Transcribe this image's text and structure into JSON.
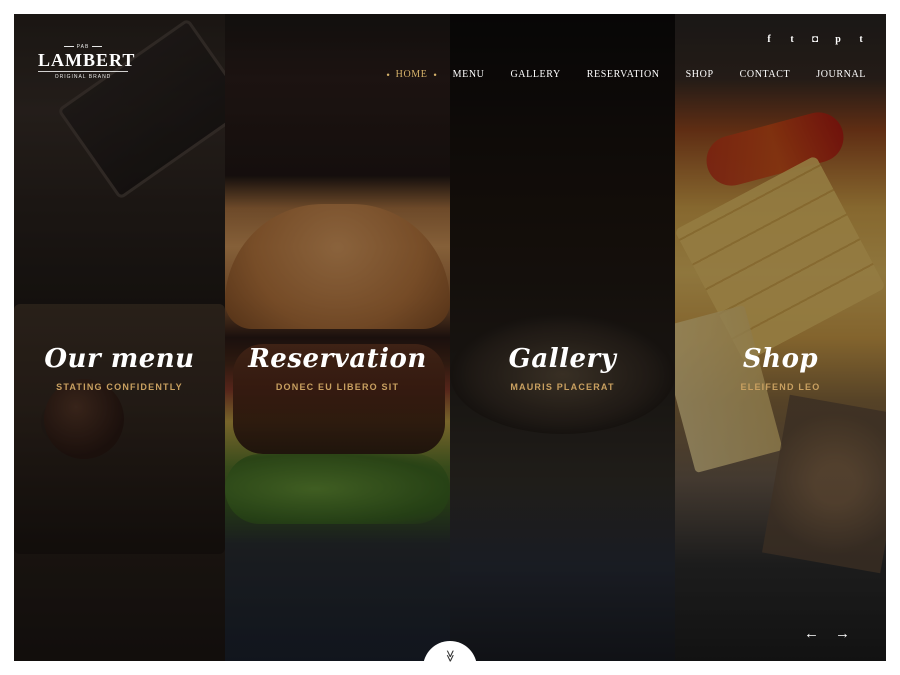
{
  "logo": {
    "top_tag": "PAB",
    "brand": "LAMBERT",
    "subtitle": "ORIGINAL BRAND"
  },
  "nav": {
    "items": [
      {
        "label": "HOME",
        "active": true
      },
      {
        "label": "MENU"
      },
      {
        "label": "GALLERY"
      },
      {
        "label": "RESERVATION"
      },
      {
        "label": "SHOP"
      },
      {
        "label": "CONTACT"
      },
      {
        "label": "JOURNAL"
      }
    ]
  },
  "social": {
    "facebook": "f",
    "twitter": "t",
    "instagram": "◘",
    "pinterest": "p",
    "tumblr": "t"
  },
  "panels": [
    {
      "title": "Our menu",
      "subtitle": "STATING CONFIDENTLY"
    },
    {
      "title": "Reservation",
      "subtitle": "DONEC EU LIBERO SIT"
    },
    {
      "title": "Gallery",
      "subtitle": "MAURIS PLACERAT"
    },
    {
      "title": "Shop",
      "subtitle": "ELEIFEND LEO"
    }
  ],
  "slider": {
    "prev": "←",
    "next": "→"
  },
  "scroll_down": "≫",
  "colors": {
    "accent": "#d6b26a",
    "subtitle_gold": "#c9a060"
  },
  "icons": {
    "facebook": "facebook-icon",
    "twitter": "twitter-icon",
    "instagram": "instagram-icon",
    "pinterest": "pinterest-icon",
    "tumblr": "tumblr-icon",
    "scroll": "chevron-double-down-icon"
  }
}
